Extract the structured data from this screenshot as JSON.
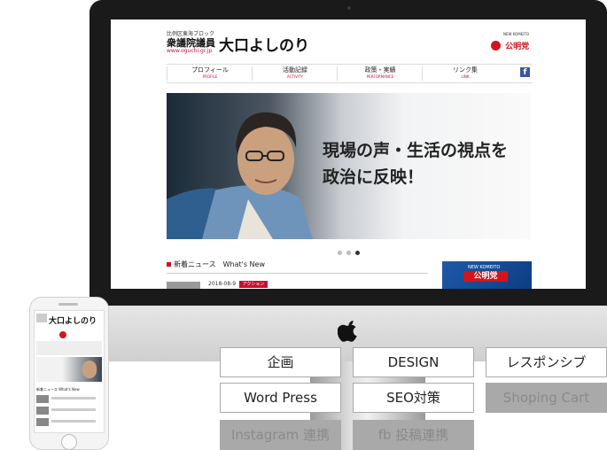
{
  "site": {
    "kicker": "比例区東海ブロック",
    "house": "衆議院議員",
    "name": "大口よしのり",
    "url": "www.oguchi.gr.jp",
    "party": {
      "en": "NEW KOMEITO",
      "jp": "公明党"
    },
    "nav": [
      {
        "jp": "プロフィール",
        "en": "PROFILE"
      },
      {
        "jp": "活動記録",
        "en": "ACTIVITY"
      },
      {
        "jp": "政策・実績",
        "en": "PERFORMANCE"
      },
      {
        "jp": "リンク集",
        "en": "LINK"
      }
    ],
    "fb_glyph": "f",
    "hero": {
      "line1": "現場の声・生活の視点を",
      "line2": "政治に反映！"
    },
    "slider_active": 3,
    "news": {
      "heading_jp": "新着ニュース",
      "heading_en": "What's New",
      "date": "2018-08-9",
      "badge": "アクション"
    },
    "banner": {
      "en": "NEW KOMEITO",
      "jp": "公明党"
    }
  },
  "phone": {
    "name": "大口よしのり",
    "news_heading": "新着ニュース What's New"
  },
  "tags": [
    {
      "label": "企画",
      "enabled": true
    },
    {
      "label": "DESIGN",
      "enabled": true
    },
    {
      "label": "レスポンシブ",
      "enabled": true
    },
    {
      "label": "Word Press",
      "enabled": true
    },
    {
      "label": "SEO対策",
      "enabled": true
    },
    {
      "label": "Shoping Cart",
      "enabled": false
    },
    {
      "label": "Instagram 連携",
      "enabled": false
    },
    {
      "label": "fb 投稿連携",
      "enabled": false
    }
  ],
  "colors": {
    "accent": "#c8102e",
    "facebook": "#3b5998",
    "banner": "#1e5aa8",
    "tag_disabled": "#a9a9a9"
  },
  "icons": {
    "apple": "apple-icon",
    "facebook": "facebook-icon",
    "party": "komeito-logo"
  }
}
